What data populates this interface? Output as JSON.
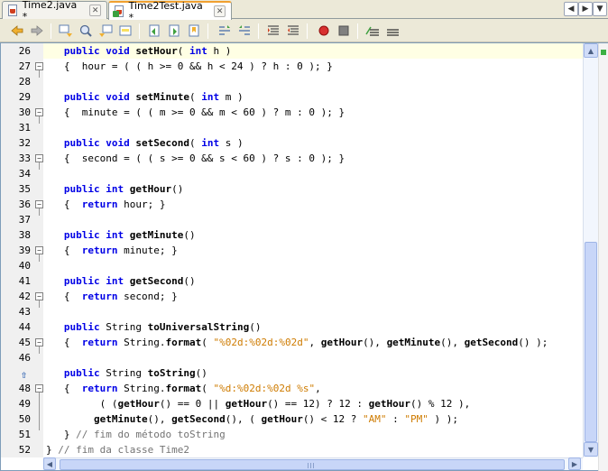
{
  "tabs": [
    {
      "label": "Time2.java *",
      "active": false
    },
    {
      "label": "Time2Test.java *",
      "active": true
    }
  ],
  "tab_nav": {
    "left": "◀",
    "right": "▶",
    "menu": "▼"
  },
  "toolbar": {
    "icons": [
      "back-icon",
      "forward-icon",
      "find-prev-icon",
      "find-icon",
      "find-next-icon",
      "toggle-highlight-icon",
      "prev-bookmark-icon",
      "next-bookmark-icon",
      "toggle-bookmark-icon",
      "shift-left-icon",
      "shift-right-icon",
      "start-macro-icon",
      "stop-macro-icon",
      "comment-icon",
      "uncomment-icon",
      "record-icon",
      "stop-icon"
    ]
  },
  "gutter": {
    "lines": [
      {
        "n": "26",
        "fold": ""
      },
      {
        "n": "27",
        "fold": "−"
      },
      {
        "n": "28",
        "fold": ""
      },
      {
        "n": "29",
        "fold": ""
      },
      {
        "n": "30",
        "fold": "−"
      },
      {
        "n": "31",
        "fold": ""
      },
      {
        "n": "32",
        "fold": ""
      },
      {
        "n": "33",
        "fold": "−"
      },
      {
        "n": "34",
        "fold": ""
      },
      {
        "n": "35",
        "fold": ""
      },
      {
        "n": "36",
        "fold": "−"
      },
      {
        "n": "37",
        "fold": ""
      },
      {
        "n": "38",
        "fold": ""
      },
      {
        "n": "39",
        "fold": "−"
      },
      {
        "n": "40",
        "fold": ""
      },
      {
        "n": "41",
        "fold": ""
      },
      {
        "n": "42",
        "fold": "−"
      },
      {
        "n": "43",
        "fold": ""
      },
      {
        "n": "44",
        "fold": ""
      },
      {
        "n": "45",
        "fold": "−"
      },
      {
        "n": "46",
        "fold": ""
      },
      {
        "n": "",
        "fold": "",
        "override": "⇧"
      },
      {
        "n": "48",
        "fold": "−"
      },
      {
        "n": "49",
        "fold": ""
      },
      {
        "n": "50",
        "fold": ""
      },
      {
        "n": "51",
        "fold": ""
      },
      {
        "n": "52",
        "fold": ""
      }
    ]
  },
  "code": {
    "l26": [
      "   ",
      "public",
      " ",
      "void",
      " ",
      "setHour",
      "( ",
      "int",
      " h )"
    ],
    "l27": "   {  hour = ( ( h >= 0 && h < 24 ) ? h : 0 ); }",
    "l29": [
      "   ",
      "public",
      " ",
      "void",
      " ",
      "setMinute",
      "( ",
      "int",
      " m )"
    ],
    "l30": "   {  minute = ( ( m >= 0 && m < 60 ) ? m : 0 ); }",
    "l32": [
      "   ",
      "public",
      " ",
      "void",
      " ",
      "setSecond",
      "( ",
      "int",
      " s )"
    ],
    "l33": "   {  second = ( ( s >= 0 && s < 60 ) ? s : 0 ); }",
    "l35": [
      "   ",
      "public",
      " ",
      "int",
      " ",
      "getHour",
      "()"
    ],
    "l36": [
      "   {  ",
      "return",
      " hour; }"
    ],
    "l38": [
      "   ",
      "public",
      " ",
      "int",
      " ",
      "getMinute",
      "()"
    ],
    "l39": [
      "   {  ",
      "return",
      " minute; }"
    ],
    "l41": [
      "   ",
      "public",
      " ",
      "int",
      " ",
      "getSecond",
      "()"
    ],
    "l42": [
      "   {  ",
      "return",
      " second; }"
    ],
    "l44": [
      "   ",
      "public",
      " String ",
      "toUniversalString",
      "()"
    ],
    "l45": [
      "   {  ",
      "return",
      " String.",
      "format",
      "( ",
      "\"%02d:%02d:%02d\"",
      ", ",
      "getHour",
      "(), ",
      "getMinute",
      "(), ",
      "getSecond",
      "() );"
    ],
    "l47": [
      "   ",
      "public",
      " String ",
      "toString",
      "()"
    ],
    "l48": [
      "   {  ",
      "return",
      " String.",
      "format",
      "( ",
      "\"%d:%02d:%02d %s\"",
      ","
    ],
    "l49": [
      "         ( (",
      "getHour",
      "() == 0 || ",
      "getHour",
      "() == 12) ? 12 : ",
      "getHour",
      "() % 12 ),"
    ],
    "l50": [
      "        ",
      "getMinute",
      "(), ",
      "getSecond",
      "(), ( ",
      "getHour",
      "() < 12 ? ",
      "\"AM\"",
      " : ",
      "\"PM\"",
      " ) );"
    ],
    "l51": [
      "   } ",
      "// fim do método toString"
    ],
    "l52": [
      "} ",
      "// fim da classe Time2"
    ]
  }
}
